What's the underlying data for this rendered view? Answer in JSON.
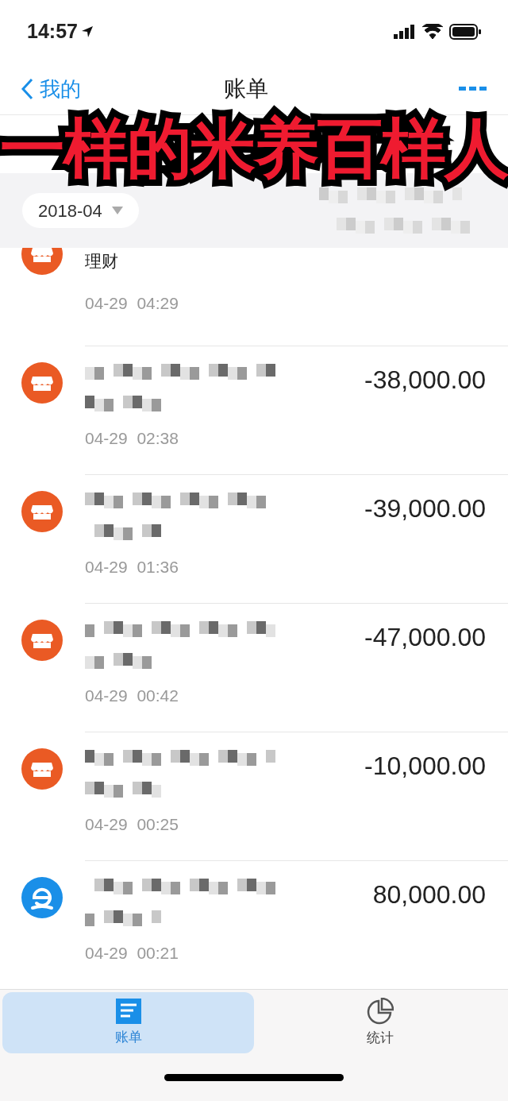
{
  "status_bar": {
    "time": "14:57"
  },
  "nav": {
    "back": "我的",
    "title": "账单"
  },
  "overlay_caption": "一样的米养百样人",
  "month_picker": {
    "value": "2018-04"
  },
  "transactions": [
    {
      "kind": "store",
      "title": "理财",
      "time": "04-29  04:29"
    },
    {
      "kind": "store",
      "time": "04-29  02:38",
      "amount": "-38,000.00"
    },
    {
      "kind": "store",
      "time": "04-29  01:36",
      "amount": "-39,000.00"
    },
    {
      "kind": "store",
      "time": "04-29  00:42",
      "amount": "-47,000.00"
    },
    {
      "kind": "store",
      "time": "04-29  00:25",
      "amount": "-10,000.00"
    },
    {
      "kind": "coin",
      "time": "04-29  00:21",
      "amount": "80,000.00"
    }
  ],
  "tabs": [
    {
      "label": "账单",
      "selected": true,
      "kind": "bill"
    },
    {
      "label": "统计",
      "selected": false,
      "kind": "pie"
    }
  ]
}
